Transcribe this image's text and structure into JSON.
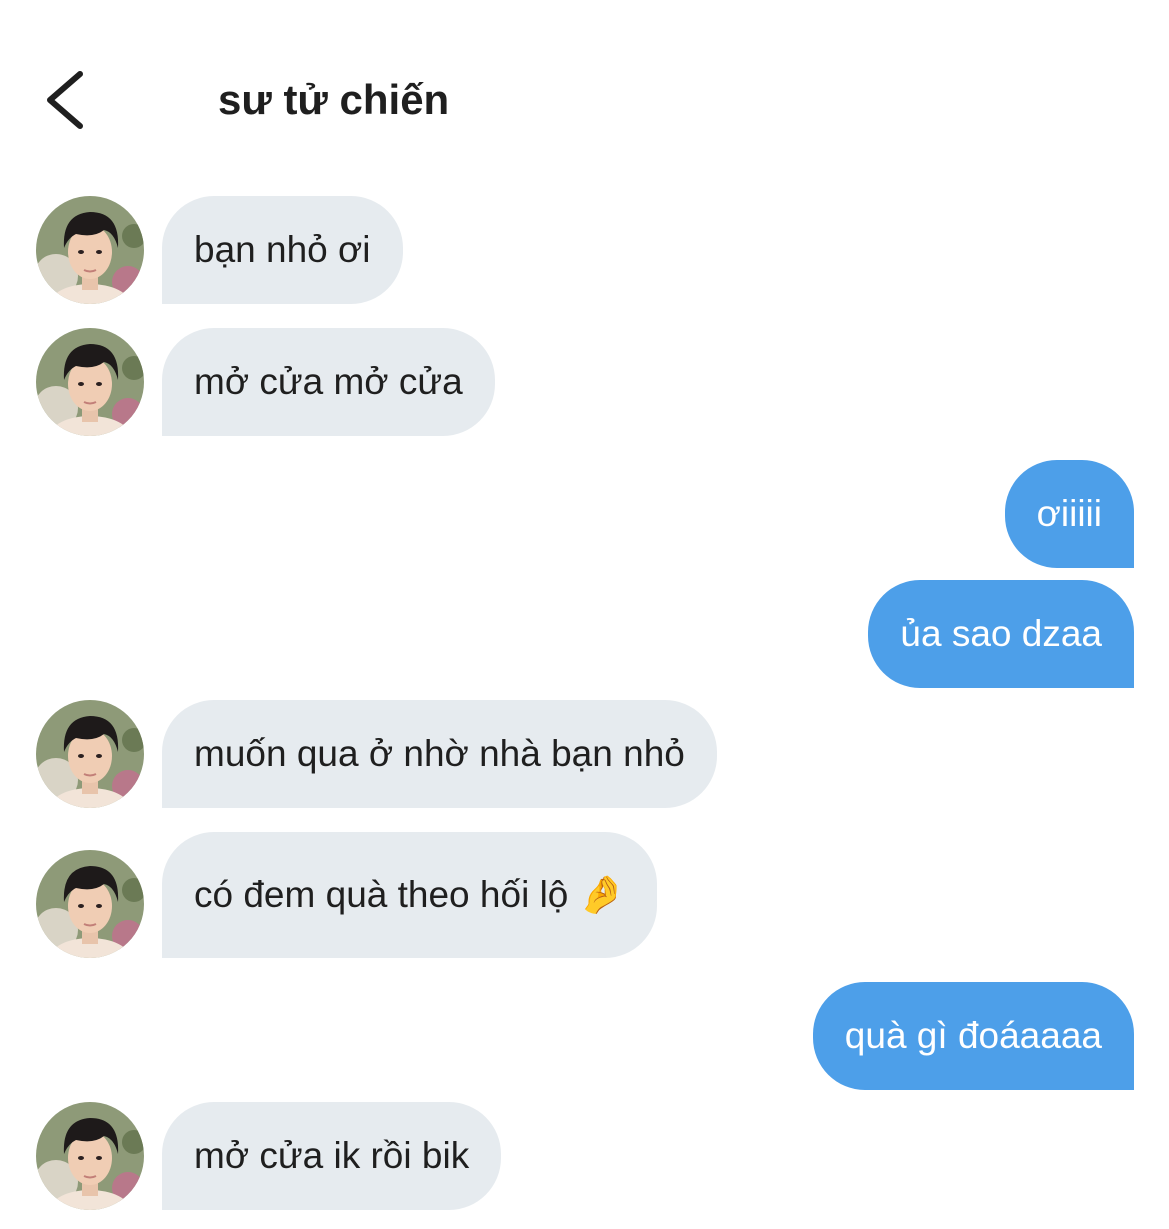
{
  "header": {
    "back_icon": "chevron-left-icon",
    "title": "sư tử chiến"
  },
  "colors": {
    "incoming_bubble": "#e6ebef",
    "outgoing_bubble": "#4d9fe9",
    "text_dark": "#1f1f1f",
    "text_light": "#ffffff"
  },
  "messages": [
    {
      "from": "contact",
      "text": "bạn nhỏ ơi"
    },
    {
      "from": "contact",
      "text": "mở cửa mở cửa"
    },
    {
      "from": "me",
      "text": "ơiiiii"
    },
    {
      "from": "me",
      "text": "ủa sao dzaa"
    },
    {
      "from": "contact",
      "text": "muốn qua ở nhờ nhà bạn nhỏ"
    },
    {
      "from": "contact",
      "text": "có đem quà theo hối lộ 🤌"
    },
    {
      "from": "me",
      "text": "quà gì đoáaaaa"
    },
    {
      "from": "contact",
      "text": "mở cửa ik rồi bik"
    }
  ]
}
